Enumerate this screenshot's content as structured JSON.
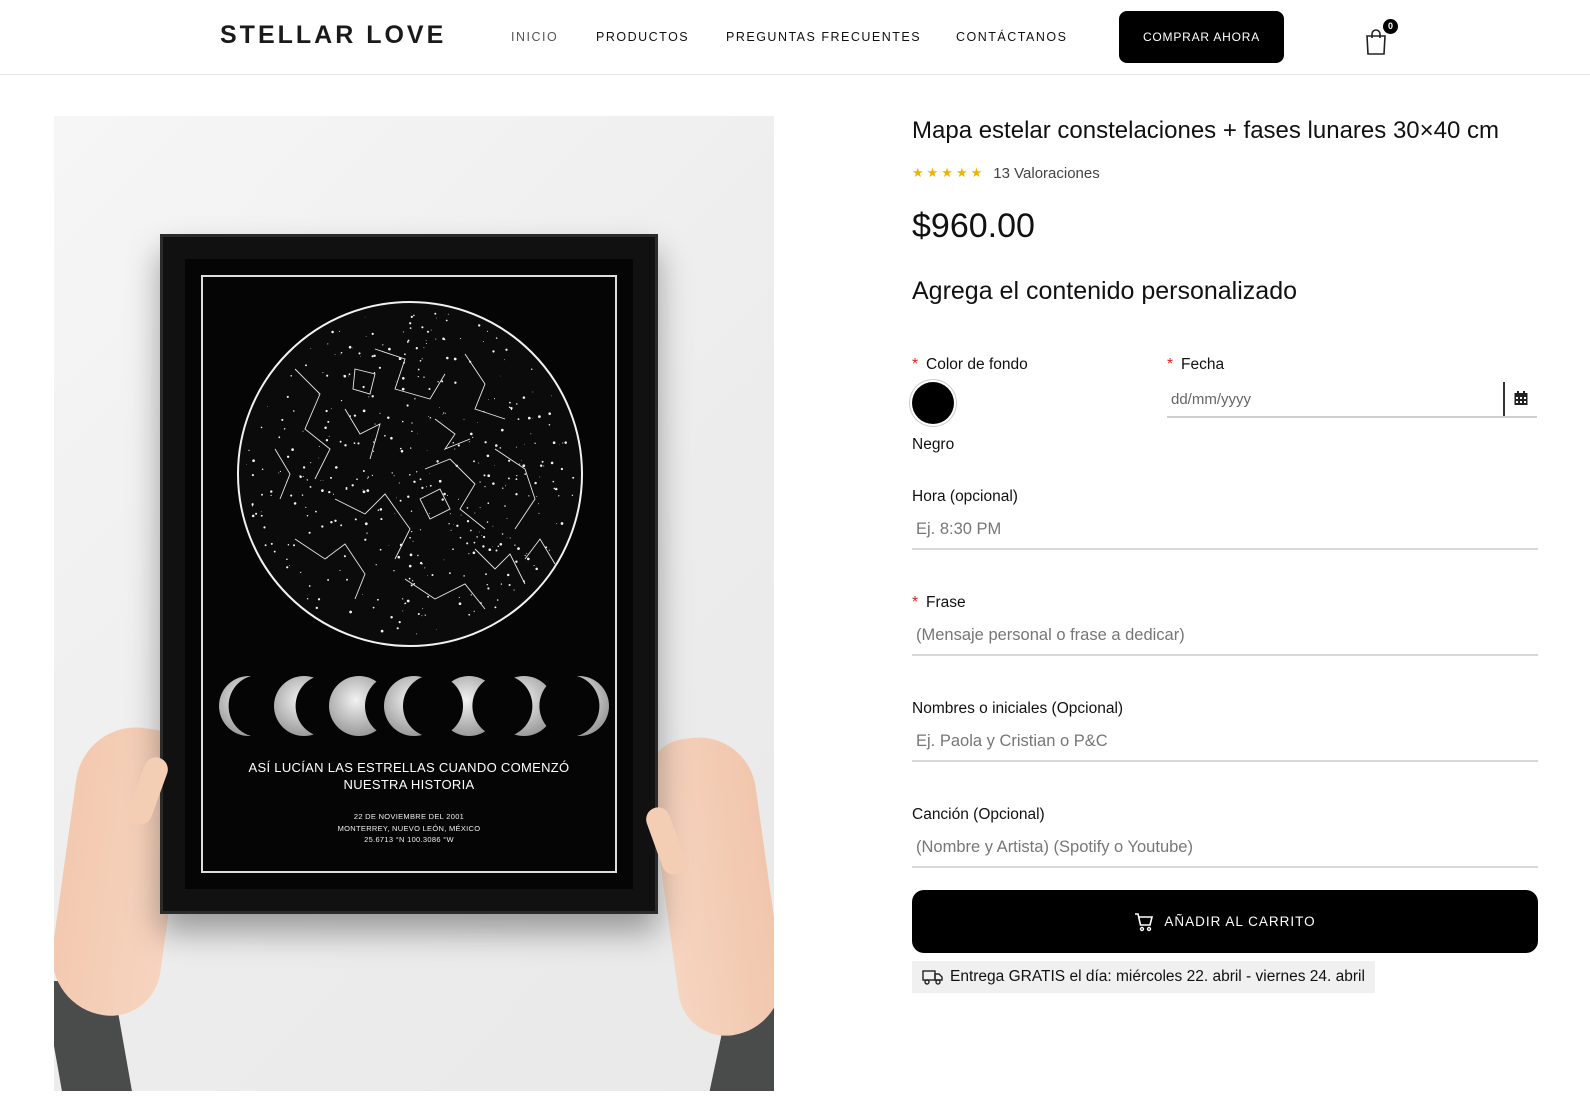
{
  "header": {
    "logo": "STELLAR LOVE",
    "nav": [
      {
        "label": "INICIO"
      },
      {
        "label": "PRODUCTOS"
      },
      {
        "label": "PREGUNTAS FRECUENTES"
      },
      {
        "label": "CONTÁCTANOS"
      }
    ],
    "buy_label": "COMPRAR AHORA",
    "cart_count": "0",
    "cart_icon": "shopping-bag-icon"
  },
  "poster": {
    "title_line1": "ASÍ LUCÍAN LAS ESTRELLAS CUANDO COMENZÓ",
    "title_line2": "NUESTRA HISTORIA",
    "date": "22 DE NOVIEMBRE DEL 2001",
    "place": "MONTERREY, NUEVO LEÓN, MÉXICO",
    "coords": "25.6713 °N   100.3086 °W"
  },
  "product": {
    "title": "Mapa estelar constelaciones + fases lunares 30×40 cm",
    "stars": "★★★★★",
    "rating_count": 5,
    "rating_text": "13 Valoraciones",
    "price": "$960.00"
  },
  "form": {
    "heading": "Agrega el contenido personalizado",
    "color": {
      "label": "Color de fondo",
      "selected": "Negro",
      "swatch_color": "#000000"
    },
    "date": {
      "label": "Fecha",
      "placeholder": "dd/mm/yyyy",
      "icon": "calendar-icon"
    },
    "hora": {
      "label": "Hora (opcional)",
      "placeholder": "Ej. 8:30 PM"
    },
    "frase": {
      "label": "Frase",
      "placeholder": "(Mensaje personal o frase a dedicar)"
    },
    "nombres": {
      "label": "Nombres o iniciales (Opcional)",
      "placeholder": "Ej. Paola y Cristian o P&C"
    },
    "cancion": {
      "label": "Canción (Opcional)",
      "placeholder": "(Nombre y Artista) (Spotify o Youtube)"
    },
    "required_mark": "*",
    "add_to_cart": "AÑADIR AL CARRITO",
    "add_icon": "cart-icon",
    "delivery": "Entrega GRATIS el día: miércoles 22. abril - viernes 24. abril",
    "delivery_icon": "truck-icon"
  },
  "colors": {
    "accent": "#000000",
    "required": "#e02020",
    "star": "#f0b400"
  }
}
